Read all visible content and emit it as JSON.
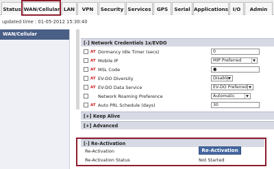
{
  "tabs": [
    {
      "label": "Status"
    },
    {
      "label": "WAN/Cellular"
    },
    {
      "label": "LAN"
    },
    {
      "label": "VPN"
    },
    {
      "label": "Security"
    },
    {
      "label": "Services"
    },
    {
      "label": "GPS"
    },
    {
      "label": "Serial"
    },
    {
      "label": "Applications"
    },
    {
      "label": "I/O"
    },
    {
      "label": "Admin"
    }
  ],
  "updated_time": "updated time : 01-05-2012 15:30:40",
  "sidebar": {
    "title": "WAN/Cellular"
  },
  "sections": {
    "network_credentials": "[-] Network Credentials 1x/EVDO",
    "keep_alive": "[+] Keep Alive",
    "advanced": "[+] Advanced",
    "reactivation": "[-] Re-Activation"
  },
  "at_marker": "AT",
  "fields": [
    {
      "label": "Dormancy Idle Timer (secs)",
      "value": "0",
      "type": "text",
      "at": true
    },
    {
      "label": "Mobile IP",
      "value": "MIP Preferred",
      "type": "select",
      "at": true
    },
    {
      "label": "MSL Code",
      "value": "●",
      "type": "text",
      "at": true
    },
    {
      "label": "EV-DO Diversity",
      "value": "Disable",
      "type": "select",
      "at": true
    },
    {
      "label": "EV-DO Data Service",
      "value": "EV-DO Preferred",
      "type": "select",
      "at": true
    },
    {
      "label": "Network Roaming Preference",
      "value": "Automatic",
      "type": "select",
      "at": false
    },
    {
      "label": "Auto PRL Schedule (days)",
      "value": "30",
      "type": "text",
      "at": true
    }
  ],
  "reactivation": {
    "label": "Re-Activation",
    "button_label": "Re-Activation",
    "status_label": "Re-Activation Status",
    "status_value": "Not Started"
  },
  "colors": {
    "sidebar_header": "#4a5f86",
    "section_bg": "#d7dae4",
    "highlight_outline": "#8b1a2b",
    "button": "#4569a0",
    "at_marker": "#d01818"
  }
}
